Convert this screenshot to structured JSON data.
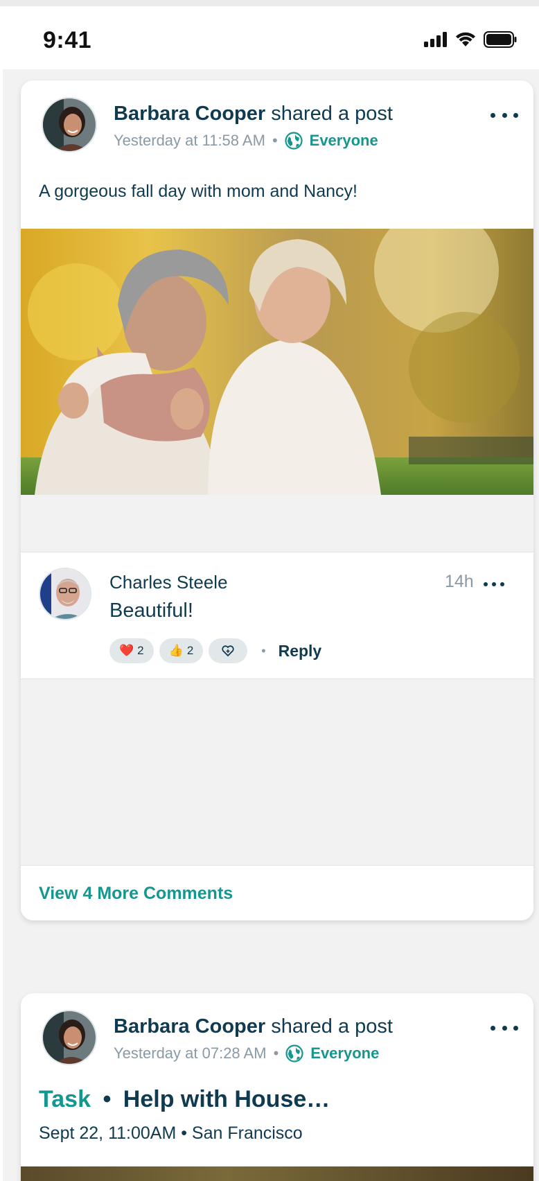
{
  "status_bar": {
    "time": "9:41"
  },
  "posts": [
    {
      "author": "Barbara Cooper",
      "action": "shared a post",
      "timestamp": "Yesterday at 11:58 AM",
      "separator": "•",
      "audience": "Everyone",
      "text": "A gorgeous fall day with mom and Nancy!",
      "comment": {
        "author": "Charles Steele",
        "time": "14h",
        "text": "Beautiful!",
        "reactions": [
          {
            "emoji": "❤️",
            "count": "2"
          },
          {
            "emoji": "👍",
            "count": "2"
          }
        ],
        "reply_label": "Reply"
      },
      "view_more_label": "View 4 More Comments"
    },
    {
      "author": "Barbara Cooper",
      "action": "shared a post",
      "timestamp": "Yesterday at 07:28 AM",
      "separator": "•",
      "audience": "Everyone",
      "task_label": "Task",
      "task_separator": "•",
      "task_title": "Help with House…",
      "schedule": "Sept 22, 11:00AM • San Francisco"
    }
  ],
  "colors": {
    "accent": "#15968f",
    "text": "#0f3a4f",
    "muted": "#8a9aa5",
    "feed_bg": "#f2f2f2"
  }
}
